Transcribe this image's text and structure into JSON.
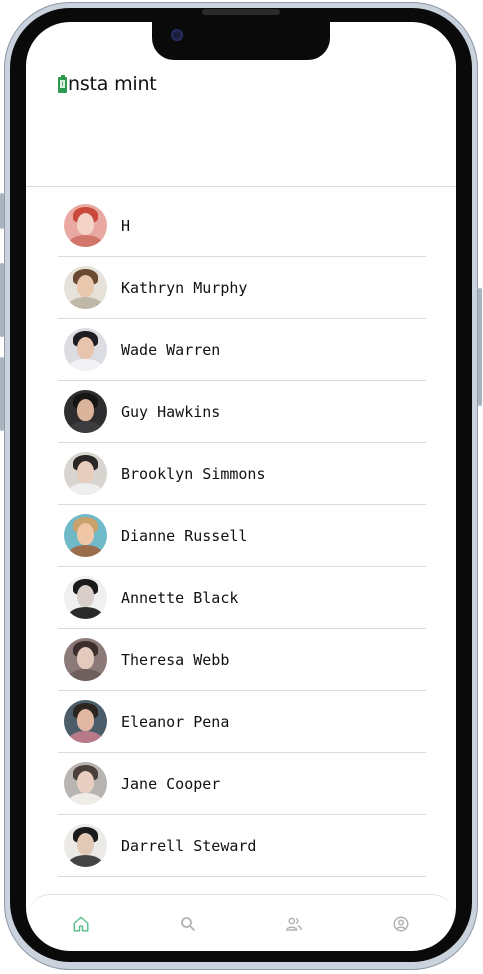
{
  "app": {
    "title": "nsta mint",
    "accent_color": "#5cc08a"
  },
  "contacts": [
    {
      "name": "H",
      "colors": {
        "bg": "#e9a9a2",
        "hair": "#c94a3d",
        "face": "#f4d2c6",
        "body": "#d2766c"
      }
    },
    {
      "name": "Kathryn Murphy",
      "colors": {
        "bg": "#e6e2d9",
        "hair": "#6b4a33",
        "face": "#e9c8ad",
        "body": "#bfb7a8"
      }
    },
    {
      "name": "Wade Warren",
      "colors": {
        "bg": "#dcdde3",
        "hair": "#1e1e22",
        "face": "#e8c4ae",
        "body": "#f2f2f4"
      }
    },
    {
      "name": "Guy Hawkins",
      "colors": {
        "bg": "#2e2e30",
        "hair": "#151515",
        "face": "#d9b39a",
        "body": "#3c3c3e"
      }
    },
    {
      "name": "Brooklyn Simmons",
      "colors": {
        "bg": "#d8d4cf",
        "hair": "#2a2624",
        "face": "#e7cdbd",
        "body": "#eeeeee"
      }
    },
    {
      "name": "Dianne Russell",
      "colors": {
        "bg": "#6fb9c9",
        "hair": "#c9a26b",
        "face": "#efc7a6",
        "body": "#9c6d4c"
      }
    },
    {
      "name": "Annette Black",
      "colors": {
        "bg": "#f0f0f0",
        "hair": "#1a1a1a",
        "face": "#d8cfcb",
        "body": "#2a2a2a"
      }
    },
    {
      "name": "Theresa Webb",
      "colors": {
        "bg": "#8b7a78",
        "hair": "#3b2e2c",
        "face": "#e4c9bd",
        "body": "#6f5f5c"
      }
    },
    {
      "name": "Eleanor Pena",
      "colors": {
        "bg": "#4c5d6a",
        "hair": "#2b2420",
        "face": "#e0b7a3",
        "body": "#b87a88"
      }
    },
    {
      "name": "Jane Cooper",
      "colors": {
        "bg": "#b8b4b2",
        "hair": "#4a3f3a",
        "face": "#e8cfc2",
        "body": "#f0ece8"
      }
    },
    {
      "name": "Darrell Steward",
      "colors": {
        "bg": "#eceae6",
        "hair": "#1b1b1b",
        "face": "#e1c9b6",
        "body": "#444444"
      }
    }
  ],
  "nav": [
    {
      "icon": "home-icon",
      "active": true
    },
    {
      "icon": "search-icon",
      "active": false
    },
    {
      "icon": "users-icon",
      "active": false
    },
    {
      "icon": "profile-icon",
      "active": false
    }
  ]
}
